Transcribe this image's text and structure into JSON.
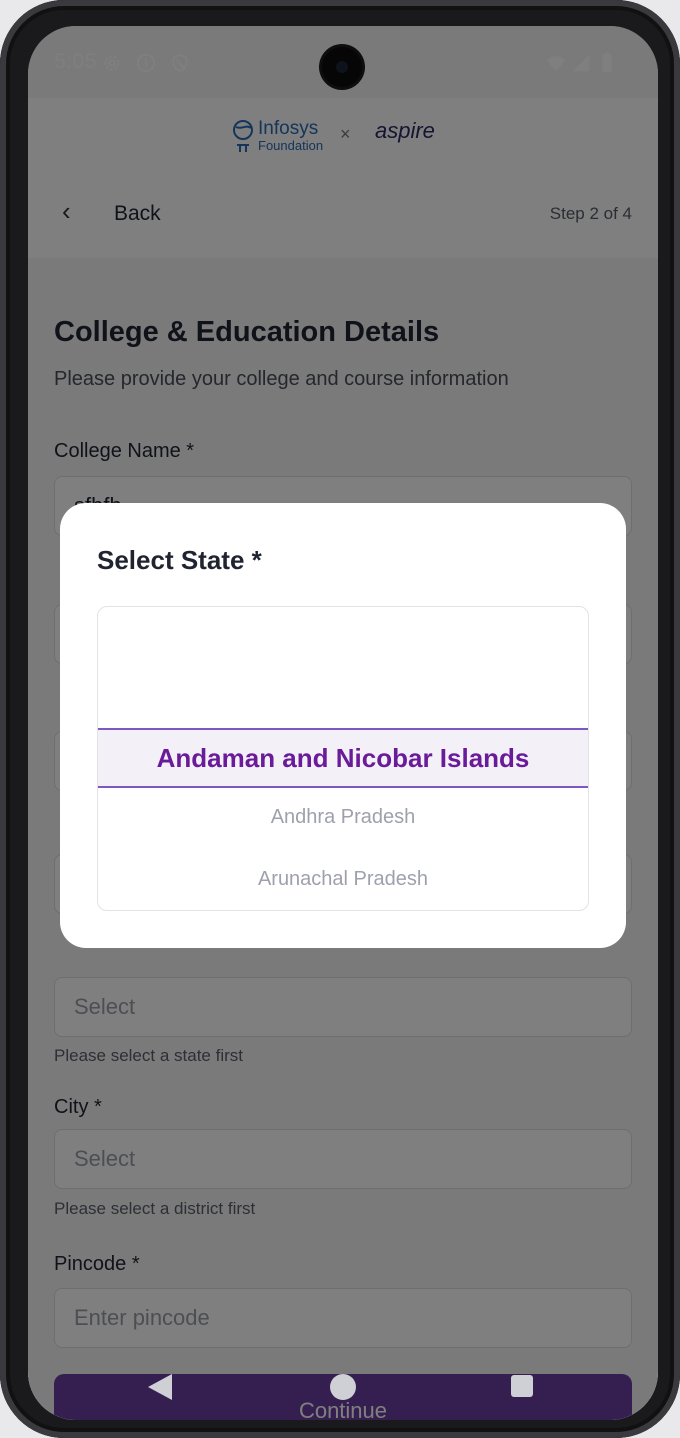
{
  "status_bar": {
    "time": "5:05",
    "icons": [
      "gear-icon",
      "info-icon",
      "shield-icon",
      "wifi-icon",
      "signal-icon",
      "battery-icon"
    ]
  },
  "header": {
    "logo_left_name": "Infosys",
    "logo_left_sub": "Foundation",
    "logo_separator": "×",
    "logo_right": "aspire"
  },
  "nav": {
    "back_label": "Back",
    "step_label": "Step 2 of 4"
  },
  "form": {
    "title": "College & Education Details",
    "subtitle": "Please provide your college and course information",
    "college_label": "College Name *",
    "college_value": "sfbfb",
    "district_placeholder": "Select",
    "district_hint": "Please select a state first",
    "city_label": "City *",
    "city_placeholder": "Select",
    "city_hint": "Please select a district first",
    "pincode_label": "Pincode *",
    "pincode_placeholder": "Enter pincode",
    "continue_label": "Continue"
  },
  "modal": {
    "title": "Select State *",
    "selected": "Andaman and Nicobar Islands",
    "options": [
      "Andhra Pradesh",
      "Arunachal Pradesh"
    ]
  },
  "colors": {
    "accent": "#6a1b9a",
    "picker_line": "#7e57c2",
    "button": "#6b3fa0"
  }
}
